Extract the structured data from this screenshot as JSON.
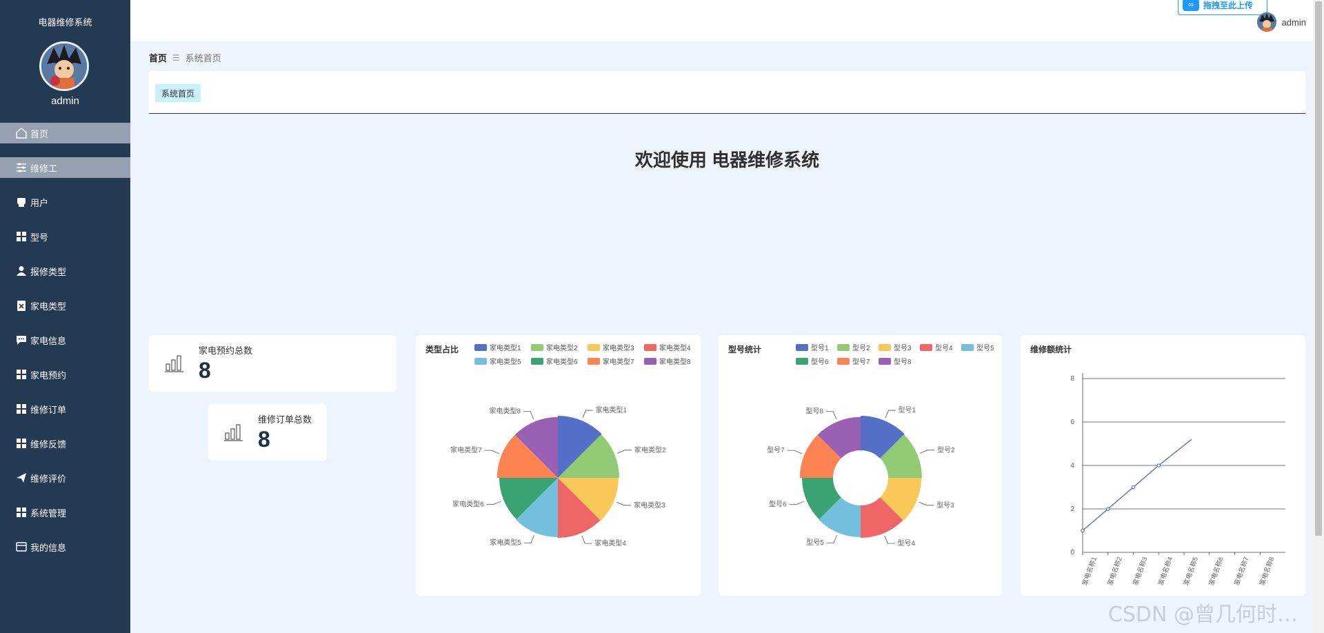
{
  "sidebar": {
    "title": "电器维修系统",
    "username": "admin",
    "items": [
      {
        "label": "首页",
        "icon": "home-icon",
        "state": "active"
      },
      {
        "label": "维修工",
        "icon": "sliders-icon",
        "state": "hover"
      },
      {
        "label": "用户",
        "icon": "printer-icon",
        "state": ""
      },
      {
        "label": "型号",
        "icon": "grid-icon",
        "state": ""
      },
      {
        "label": "报修类型",
        "icon": "user-icon",
        "state": ""
      },
      {
        "label": "家电类型",
        "icon": "clipboard-x-icon",
        "state": ""
      },
      {
        "label": "家电信息",
        "icon": "message-icon",
        "state": ""
      },
      {
        "label": "家电预约",
        "icon": "grid-icon",
        "state": ""
      },
      {
        "label": "维修订单",
        "icon": "grid-icon",
        "state": ""
      },
      {
        "label": "维修反馈",
        "icon": "grid-icon",
        "state": ""
      },
      {
        "label": "维修评价",
        "icon": "send-icon",
        "state": ""
      },
      {
        "label": "系统管理",
        "icon": "grid-icon",
        "state": ""
      },
      {
        "label": "我的信息",
        "icon": "card-icon",
        "state": ""
      }
    ]
  },
  "header": {
    "upload_label": "拖拽至此上传",
    "username": "admin"
  },
  "breadcrumb": {
    "home": "首页",
    "separator": "☰",
    "current": "系统首页"
  },
  "tags": [
    "系统首页"
  ],
  "welcome": "欢迎使用 电器维修系统",
  "stats": [
    {
      "label": "家电预约总数",
      "value": "8"
    },
    {
      "label": "维修订单总数",
      "value": "8"
    }
  ],
  "colors": [
    "#5470c6",
    "#91cc75",
    "#fac858",
    "#ee6666",
    "#73c0de",
    "#3ba272",
    "#fc8452",
    "#9a60b4"
  ],
  "chart_data": [
    {
      "type": "pie",
      "variant": "rose",
      "title": "类型占比",
      "labels": [
        "家电类型1",
        "家电类型2",
        "家电类型3",
        "家电类型4",
        "家电类型5",
        "家电类型6",
        "家电类型7",
        "家电类型8"
      ],
      "values": [
        1,
        1,
        1,
        1,
        1,
        1,
        1,
        1
      ],
      "legend_position": "top-right"
    },
    {
      "type": "pie",
      "variant": "rose-donut",
      "title": "型号统计",
      "labels": [
        "型号1",
        "型号2",
        "型号3",
        "型号4",
        "型号5",
        "型号6",
        "型号7",
        "型号8"
      ],
      "values": [
        1,
        1,
        1,
        1,
        1,
        1,
        1,
        1
      ],
      "legend_position": "top-right"
    },
    {
      "type": "line",
      "title": "维修额统计",
      "categories": [
        "家电名称1",
        "家电名称2",
        "家电名称3",
        "家电名称4",
        "家电名称5",
        "家电名称6",
        "家电名称7",
        "家电名称8"
      ],
      "values": [
        1,
        2,
        3,
        4,
        5.2
      ],
      "ylim": [
        0,
        8
      ],
      "yticks": [
        0,
        2,
        4,
        6,
        8
      ],
      "grid": true
    }
  ],
  "watermark": "CSDN @曾几何时…"
}
